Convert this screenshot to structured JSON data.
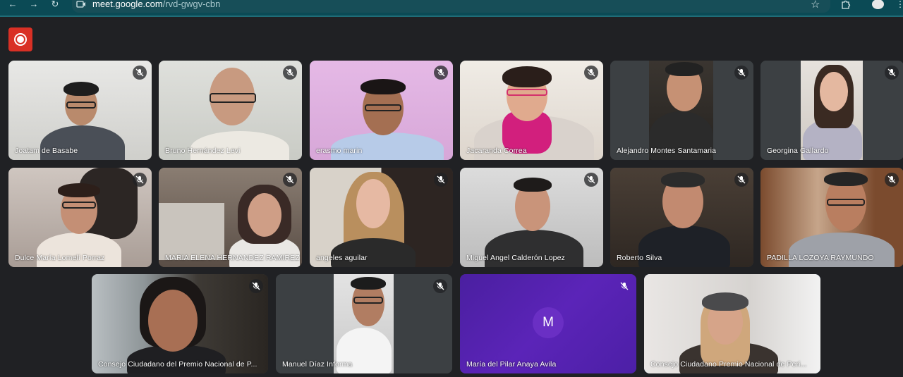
{
  "browser": {
    "url_host": "meet.google.com",
    "url_path": "/rvd-gwgv-cbn"
  },
  "meet": {
    "participants": [
      {
        "name": "Joatam de Basabe"
      },
      {
        "name": "Bruno Hernández Levi"
      },
      {
        "name": "erasmo marin"
      },
      {
        "name": "Jacaranda Correa"
      },
      {
        "name": "Alejandro Montes Santamaria"
      },
      {
        "name": "Georgina Gallardo"
      },
      {
        "name": "Dulce María Lomelí Porraz"
      },
      {
        "name": "MARIA ELENA HERNANDEZ RAMIREZ"
      },
      {
        "name": "angeles aguilar"
      },
      {
        "name": "Miguel Angel Calderón Lopez"
      },
      {
        "name": "Roberto Silva"
      },
      {
        "name": "PADILLA LOZOYA RAYMUNDO"
      },
      {
        "name": "Consejo Ciudadano del Premio Nacional de P..."
      },
      {
        "name": "Manuel Díaz Informa"
      },
      {
        "name": "María del Pilar Anaya Avila",
        "avatar_letter": "M"
      },
      {
        "name": "Consejo Ciudadano Premio Nacional de Peri..."
      }
    ]
  },
  "colors": {
    "chrome_bg": "#0b4a55",
    "meet_bg": "#202124",
    "record": "#d93025",
    "avatar_tile": "#5b24b8",
    "active_border": "#8ab4f8"
  },
  "icons": [
    "back-icon",
    "forward-icon",
    "reload-icon",
    "site-info-icon",
    "star-icon",
    "extensions-icon",
    "profile-icon",
    "menu-icon",
    "record-icon",
    "mic-off-icon"
  ]
}
